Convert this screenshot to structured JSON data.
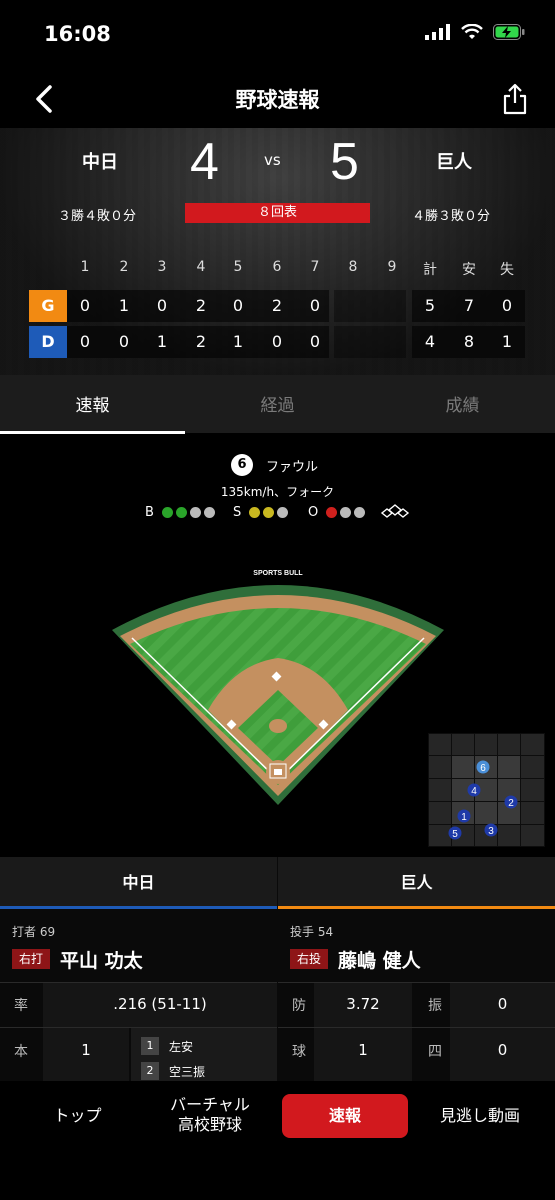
{
  "status": {
    "time": "16:08"
  },
  "nav": {
    "title": "野球速報"
  },
  "game": {
    "home_team": "中日",
    "away_team": "巨人",
    "home_score": "4",
    "away_score": "5",
    "vs": "vs",
    "home_record": "３勝４敗０分",
    "away_record": "４勝３敗０分",
    "inning": "８回表"
  },
  "linescore": {
    "headers": [
      "1",
      "2",
      "3",
      "4",
      "5",
      "6",
      "7",
      "8",
      "9",
      "計",
      "安",
      "失"
    ],
    "rows": [
      {
        "tag": "G",
        "cells": [
          "0",
          "1",
          "0",
          "2",
          "0",
          "2",
          "0",
          "",
          "",
          "5",
          "7",
          "0"
        ]
      },
      {
        "tag": "D",
        "cells": [
          "0",
          "0",
          "1",
          "2",
          "1",
          "0",
          "0",
          "",
          "",
          "4",
          "8",
          "1"
        ]
      }
    ]
  },
  "tabs": [
    "速報",
    "経過",
    "成績"
  ],
  "pitch": {
    "number": "6",
    "result": "ファウル",
    "speed": "135km/h、フォーク",
    "b_label": "B",
    "s_label": "S",
    "o_label": "O"
  },
  "field": {
    "banner": "SPORTS BULL"
  },
  "zone": {
    "pitches": [
      "1",
      "2",
      "3",
      "4",
      "5",
      "6"
    ]
  },
  "batter_side": {
    "team": "中日",
    "role": "打者 69",
    "hand": "右打",
    "name": "平山 功太",
    "rate_label": "率",
    "rate_value": ".216 (51-11)",
    "hr_label": "本",
    "hr_value": "1",
    "history": [
      {
        "no": "1",
        "text": "左安"
      },
      {
        "no": "2",
        "text": "空三振"
      }
    ]
  },
  "pitcher_side": {
    "team": "巨人",
    "role": "投手 54",
    "hand": "右投",
    "name": "藤嶋 健人",
    "era_label": "防",
    "era_value": "3.72",
    "k_label": "振",
    "k_value": "0",
    "pitch_label": "球",
    "pitch_value": "1",
    "bb_label": "四",
    "bb_value": "0"
  },
  "bottom_nav": {
    "top": "トップ",
    "virtual_line1": "バーチャル",
    "virtual_line2": "高校野球",
    "live": "速報",
    "video": "見逃し動画"
  },
  "colors": {
    "accent_red": "#d2191e",
    "giants_orange": "#f28a12",
    "dragons_blue": "#1e5bb8",
    "ball_green": "#2aa52a",
    "strike_yellow": "#c9b820"
  }
}
